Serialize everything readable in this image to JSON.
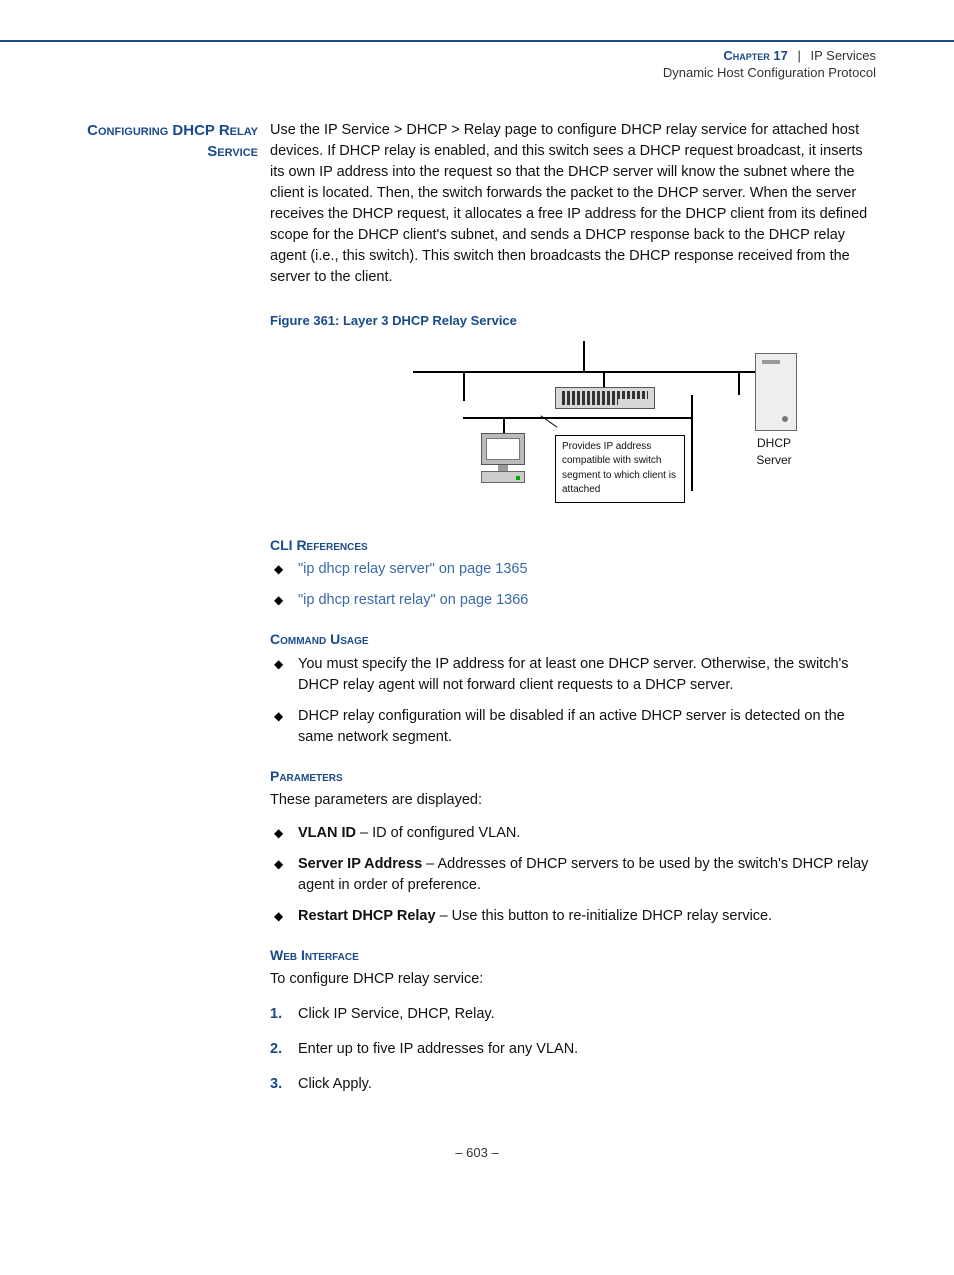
{
  "header": {
    "chapter": "Chapter 17",
    "separator": "|",
    "title": "IP Services",
    "subtitle": "Dynamic Host Configuration Protocol"
  },
  "sidehead": "Configuring DHCP Relay Service",
  "intro_para": "Use the IP Service > DHCP > Relay page to configure DHCP relay service for attached host devices. If DHCP relay is enabled, and this switch sees a DHCP request broadcast, it inserts its own IP address into the request so that the DHCP server will know the subnet where the client is located. Then, the switch forwards the packet to the DHCP server. When the server receives the DHCP request, it allocates a free IP address for the DHCP client from its defined scope for the DHCP client's subnet, and sends a DHCP response back to the DHCP relay agent (i.e., this switch). This switch then broadcasts the DHCP response received from the server to the client.",
  "figure": {
    "caption": "Figure 361:  Layer 3 DHCP Relay Service",
    "callout": "Provides IP address compatible with switch segment to which client is attached",
    "server_label": "DHCP Server"
  },
  "cli_refs": {
    "heading": "CLI References",
    "items": [
      "\"ip dhcp relay server\" on page 1365",
      "\"ip dhcp restart relay\" on page 1366"
    ]
  },
  "command_usage": {
    "heading": "Command Usage",
    "items": [
      "You must specify the IP address for at least one DHCP server. Otherwise, the switch's DHCP relay agent will not forward client requests to a DHCP server.",
      "DHCP relay configuration will be disabled if an active DHCP server is detected on the same network segment."
    ]
  },
  "parameters": {
    "heading": "Parameters",
    "intro": "These parameters are displayed:",
    "items": [
      {
        "name": "VLAN ID",
        "desc": " – ID of configured VLAN."
      },
      {
        "name": "Server IP Address",
        "desc": " – Addresses of DHCP servers to be used by the switch's DHCP relay agent in order of preference."
      },
      {
        "name": "Restart DHCP Relay",
        "desc": " – Use this button to re-initialize DHCP relay service."
      }
    ]
  },
  "web_interface": {
    "heading": "Web Interface",
    "intro": "To configure DHCP relay service:",
    "steps": [
      "Click IP Service, DHCP, Relay.",
      "Enter up to five IP addresses for any VLAN.",
      "Click Apply."
    ]
  },
  "pagenum": "–  603  –"
}
